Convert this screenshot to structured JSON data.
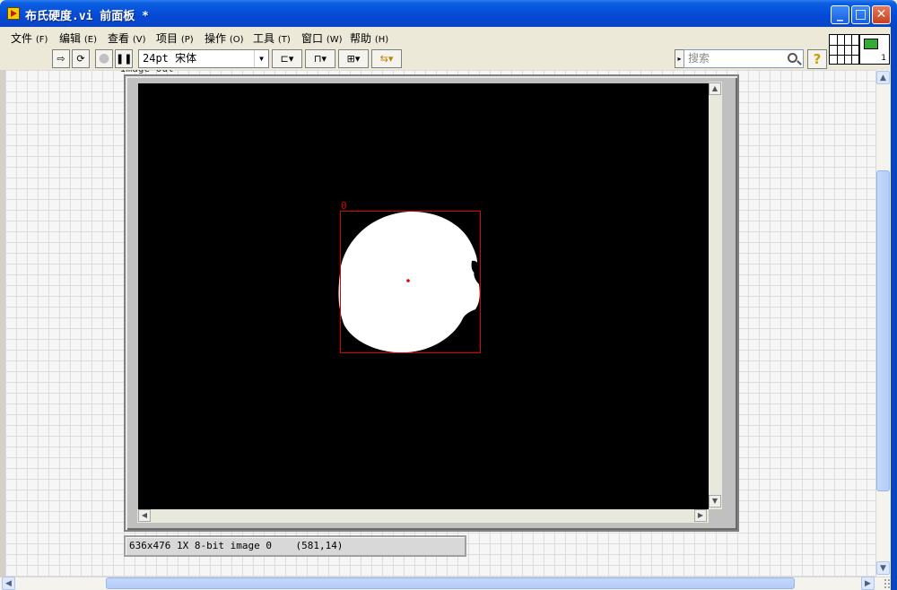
{
  "window": {
    "title": "布氏硬度.vi 前面板 *"
  },
  "menu": {
    "items": [
      {
        "label": "文件",
        "accel": "(F)"
      },
      {
        "label": "编辑",
        "accel": "(E)"
      },
      {
        "label": "查看",
        "accel": "(V)"
      },
      {
        "label": "项目",
        "accel": "(P)"
      },
      {
        "label": "操作",
        "accel": "(O)"
      },
      {
        "label": "工具",
        "accel": "(T)"
      },
      {
        "label": "窗口",
        "accel": "(W)"
      },
      {
        "label": "帮助",
        "accel": "(H)"
      }
    ]
  },
  "toolbar": {
    "font_value": "24pt 宋体",
    "search_placeholder": "搜索",
    "help_label": "?",
    "connector_number": "1"
  },
  "image_display": {
    "label": "Image Out",
    "roi_label": "0",
    "status_info": "636x476 1X 8-bit image 0",
    "cursor_coords": "(581,14)"
  },
  "colors": {
    "roi": "#e00000",
    "blob": "#ffffff",
    "background": "#000000",
    "titlebar": "#0a5fe0"
  },
  "icons": [
    "run-arrow-icon",
    "run-continuously-icon",
    "abort-icon",
    "pause-icon",
    "align-icon",
    "distribute-icon",
    "resize-icon",
    "reorder-icon",
    "search-icon",
    "help-icon"
  ]
}
